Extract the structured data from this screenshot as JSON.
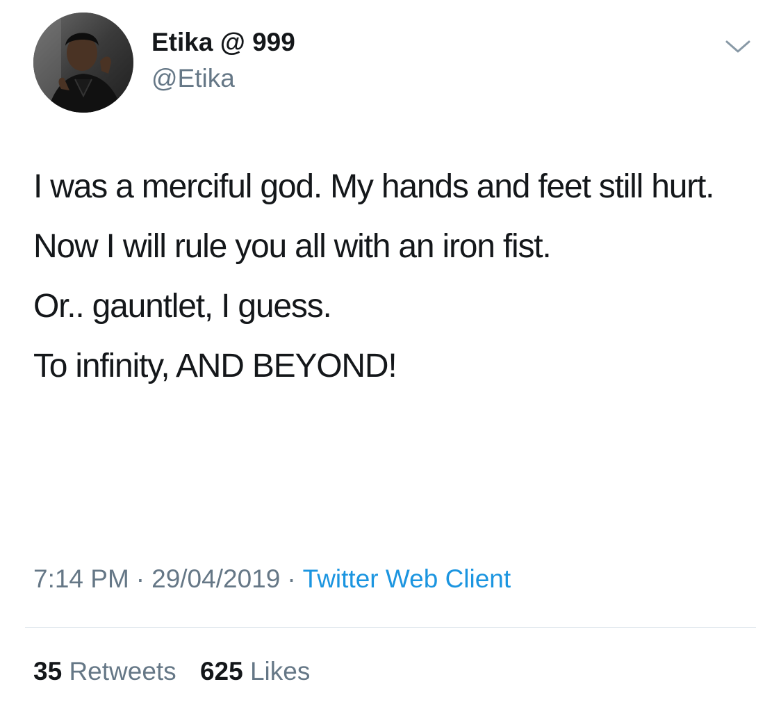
{
  "user": {
    "display_name": "Etika @ 999",
    "handle": "@Etika"
  },
  "tweet": {
    "lines": [
      "I was a merciful god.  My hands and feet still hurt.",
      "Now I will rule you all with an iron fist.",
      "Or.. gauntlet, I guess.",
      "To infinity, AND BEYOND!"
    ]
  },
  "meta": {
    "time": "7:14 PM",
    "separator": "·",
    "date": "29/04/2019",
    "client": "Twitter Web Client"
  },
  "stats": {
    "retweets_count": "35",
    "retweets_label": "Retweets",
    "likes_count": "625",
    "likes_label": "Likes"
  },
  "icons": {
    "more": "chevron-down-icon"
  },
  "colors": {
    "text": "#14171a",
    "secondary": "#657786",
    "link": "#1b95e0",
    "divider": "#e1e8ed"
  }
}
